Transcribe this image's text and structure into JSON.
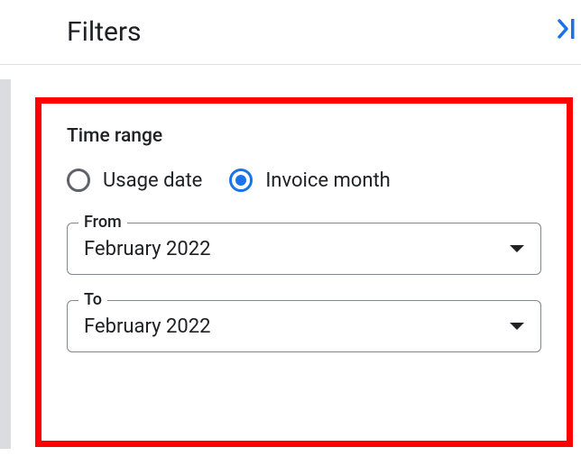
{
  "header": {
    "title": "Filters",
    "collapse_symbol": "❯|"
  },
  "time_range": {
    "section_title": "Time range",
    "options": [
      {
        "label": "Usage date",
        "selected": false
      },
      {
        "label": "Invoice month",
        "selected": true
      }
    ],
    "from": {
      "label": "From",
      "value": "February 2022"
    },
    "to": {
      "label": "To",
      "value": "February 2022"
    }
  }
}
